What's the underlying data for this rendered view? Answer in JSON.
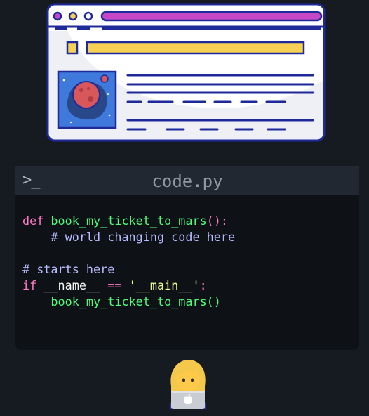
{
  "illustration": {
    "colors": {
      "outline": "#1f2a9a",
      "dot": "#c548c6",
      "address_bar": "#c548c6",
      "title_bar": "#f7d154",
      "planet": "#d8575b",
      "thumbnail": "#3f79dc"
    }
  },
  "editor": {
    "prompt_symbol": ">_",
    "file_name": "code.py",
    "code_lines": [
      [
        {
          "t": "def ",
          "c": "kw"
        },
        {
          "t": "book_my_ticket_to_mars",
          "c": "fn"
        },
        {
          "t": "():",
          "c": "kw"
        }
      ],
      [
        {
          "t": "    # world changing code here",
          "c": "cm"
        }
      ],
      [],
      [
        {
          "t": "# starts here",
          "c": "cm"
        }
      ],
      [
        {
          "t": "if ",
          "c": "kw"
        },
        {
          "t": "__name__ ",
          "c": "pl"
        },
        {
          "t": "== ",
          "c": "op"
        },
        {
          "t": "'__main__'",
          "c": "st"
        },
        {
          "t": ":",
          "c": "kw"
        }
      ],
      [
        {
          "t": "    book_my_ticket_to_mars()",
          "c": "fn"
        }
      ]
    ],
    "colors": {
      "keyword": "#ff79c6",
      "function": "#50fa7b",
      "comment": "#b6bcff",
      "string": "#f1fa8c",
      "background": "#0e1116",
      "titlebar": "#212832"
    }
  },
  "developer": {
    "icon": "woman-technologist-icon"
  }
}
